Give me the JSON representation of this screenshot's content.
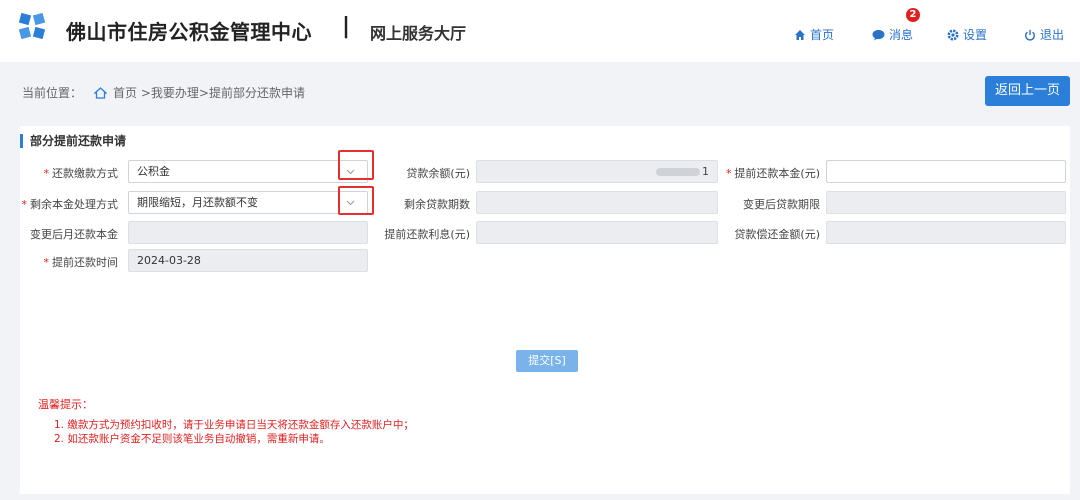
{
  "header": {
    "title": "佛山市住房公积金管理中心",
    "separator": "|",
    "subtitle": "网上服务大厅",
    "nav": {
      "home": "首页",
      "messages": "消息",
      "messages_badge": "2",
      "settings": "设置",
      "logout": "退出"
    }
  },
  "breadcrumb": {
    "prefix": "当前位置：",
    "path": "首页 >我要办理>提前部分还款申请"
  },
  "back_button": "返回上一页",
  "form": {
    "title": "部分提前还款申请",
    "fields": {
      "repay_method": {
        "label": "还款缴款方式",
        "value": "公积金",
        "required": true
      },
      "remaining_handling": {
        "label": "剩余本金处理方式",
        "value": "期限缩短，月还款额不变",
        "required": true
      },
      "after_monthly_principal": {
        "label": "变更后月还款本金",
        "value": ""
      },
      "prepay_date": {
        "label": "提前还款时间",
        "value": "2024-03-28",
        "required": true
      },
      "loan_balance": {
        "label": "贷款余额(元)",
        "value": "1"
      },
      "remaining_periods": {
        "label": "剩余贷款期数",
        "value": ""
      },
      "prepay_interest": {
        "label": "提前还款利息(元)",
        "value": ""
      },
      "prepay_principal": {
        "label": "提前还款本金(元)",
        "value": "",
        "required": true
      },
      "after_loan_term": {
        "label": "变更后贷款期限",
        "value": ""
      },
      "loan_total_repaid": {
        "label": "贷款偿还金额(元)",
        "value": ""
      }
    },
    "required_mark": "*",
    "submit": "提交[S]"
  },
  "tips": {
    "title": "温馨提示：",
    "items": [
      "1. 缴款方式为预约扣收时，请于业务申请日当天将还款金额存入还款账户中；",
      "2. 如还款账户资金不足则该笔业务自动撤销，需重新申请。"
    ]
  },
  "colors": {
    "accent": "#2b7fd8",
    "warning": "#e02020",
    "background": "#f1f3f6"
  }
}
